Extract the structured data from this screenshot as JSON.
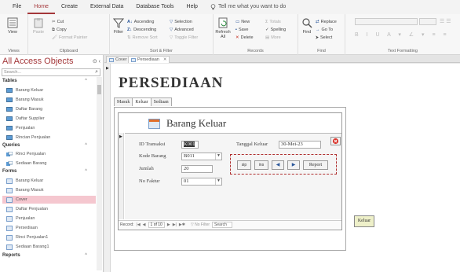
{
  "menubar": {
    "items": [
      "File",
      "Home",
      "Create",
      "External Data",
      "Database Tools",
      "Help"
    ],
    "active": "Home",
    "tell_me": "Tell me what you want to do"
  },
  "ribbon": {
    "views": {
      "view_label": "View",
      "group": "Views"
    },
    "clipboard": {
      "paste": "Paste",
      "cut": "Cut",
      "copy": "Copy",
      "format_painter": "Format Painter",
      "group": "Clipboard"
    },
    "sort_filter": {
      "filter": "Filter",
      "ascending": "Ascending",
      "descending": "Descending",
      "remove_sort": "Remove Sort",
      "selection": "Selection",
      "advanced": "Advanced",
      "toggle_filter": "Toggle Filter",
      "group": "Sort & Filter"
    },
    "records": {
      "refresh": "Refresh All",
      "new": "New",
      "save": "Save",
      "delete": "Delete",
      "totals": "Totals",
      "spelling": "Spelling",
      "more": "More",
      "group": "Records"
    },
    "find": {
      "find": "Find",
      "replace": "Replace",
      "goto": "Go To",
      "select": "Select",
      "group": "Find"
    },
    "text_formatting": {
      "group": "Text Formatting"
    }
  },
  "nav": {
    "title": "All Access Objects",
    "search_placeholder": "Search...",
    "sections": [
      {
        "label": "Tables",
        "items": [
          "Barang Keluar",
          "Barang Masuk",
          "Daftar Barang",
          "Daftar Supplier",
          "Penjualan",
          "Rincian Penjualan"
        ]
      },
      {
        "label": "Queries",
        "items": [
          "Rinci Penjualan",
          "Sediaan Barang"
        ]
      },
      {
        "label": "Forms",
        "items": [
          "Barang Keluar",
          "Barang Masuk",
          "Cover",
          "Daftar Penjualan",
          "Penjualan",
          "Persediaan",
          "Rinci Penjualan1",
          "Sediaan Barang1"
        ]
      },
      {
        "label": "Reports",
        "items": []
      }
    ],
    "selected": "Cover"
  },
  "doc_tabs": [
    "Cover",
    "Persediaan"
  ],
  "form": {
    "title": "PERSEDIAAN",
    "tabs": [
      "Masuk",
      "Keluar",
      "Sediaan"
    ],
    "active_tab": "Keluar",
    "sub_title": "Barang Keluar",
    "fields": {
      "id_label": "ID Transaksi",
      "id_value": "K001",
      "kode_label": "Kode Barang",
      "kode_value": "B011",
      "jumlah_label": "Jumlah",
      "jumlah_value": "20",
      "faktur_label": "No Faktur",
      "faktur_value": "01",
      "tanggal_label": "Tanggal Keluar",
      "tanggal_value": "30-Mei-23"
    },
    "nav_buttons": {
      "save": "sip",
      "new": "ins",
      "report": "Report"
    },
    "record_nav": {
      "record_label": "Record:",
      "position": "1 of 10",
      "filter": "No Filter",
      "search": "Search"
    },
    "keluar_button": "Keluar"
  }
}
